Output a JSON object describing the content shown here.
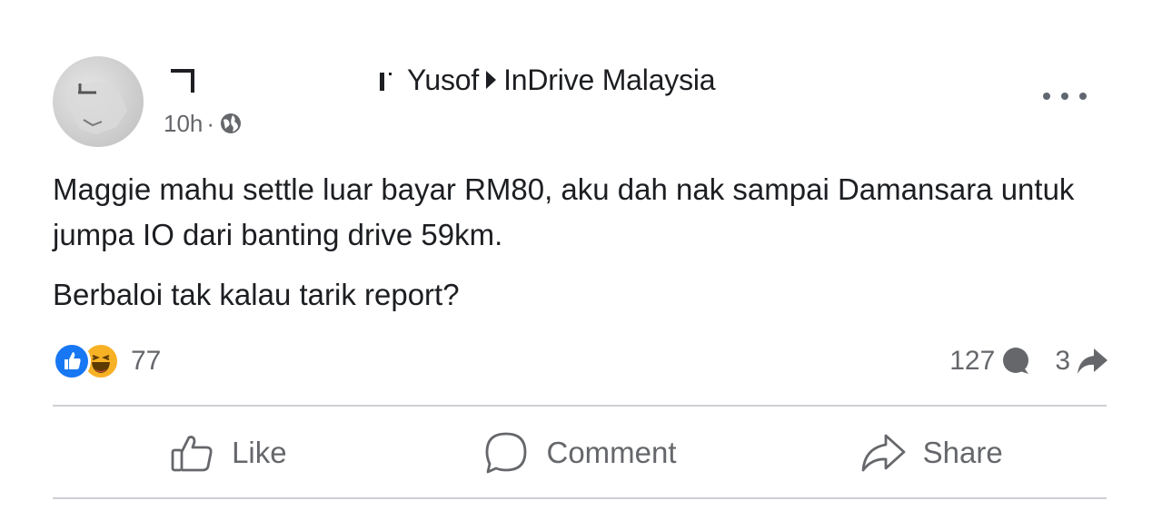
{
  "post": {
    "author_prefix": "Yusof",
    "group_name": "InDrive Malaysia",
    "time": "10h",
    "separator": "·",
    "body_paragraphs": [
      "Maggie mahu settle luar bayar RM80, aku dah nak sampai Damansara untuk jumpa IO dari banting drive 59km.",
      "Berbaloi tak kalau tarik report?"
    ]
  },
  "reactions": {
    "count": "77",
    "types": [
      "like-icon",
      "haha-icon"
    ]
  },
  "stats": {
    "comments": "127",
    "shares": "3"
  },
  "actions": {
    "like_label": "Like",
    "comment_label": "Comment",
    "share_label": "Share"
  },
  "colors": {
    "like_blue": "#1877f2",
    "haha_yellow": "#f7b125",
    "secondary_text": "#65676b",
    "divider": "#ced0d4"
  }
}
